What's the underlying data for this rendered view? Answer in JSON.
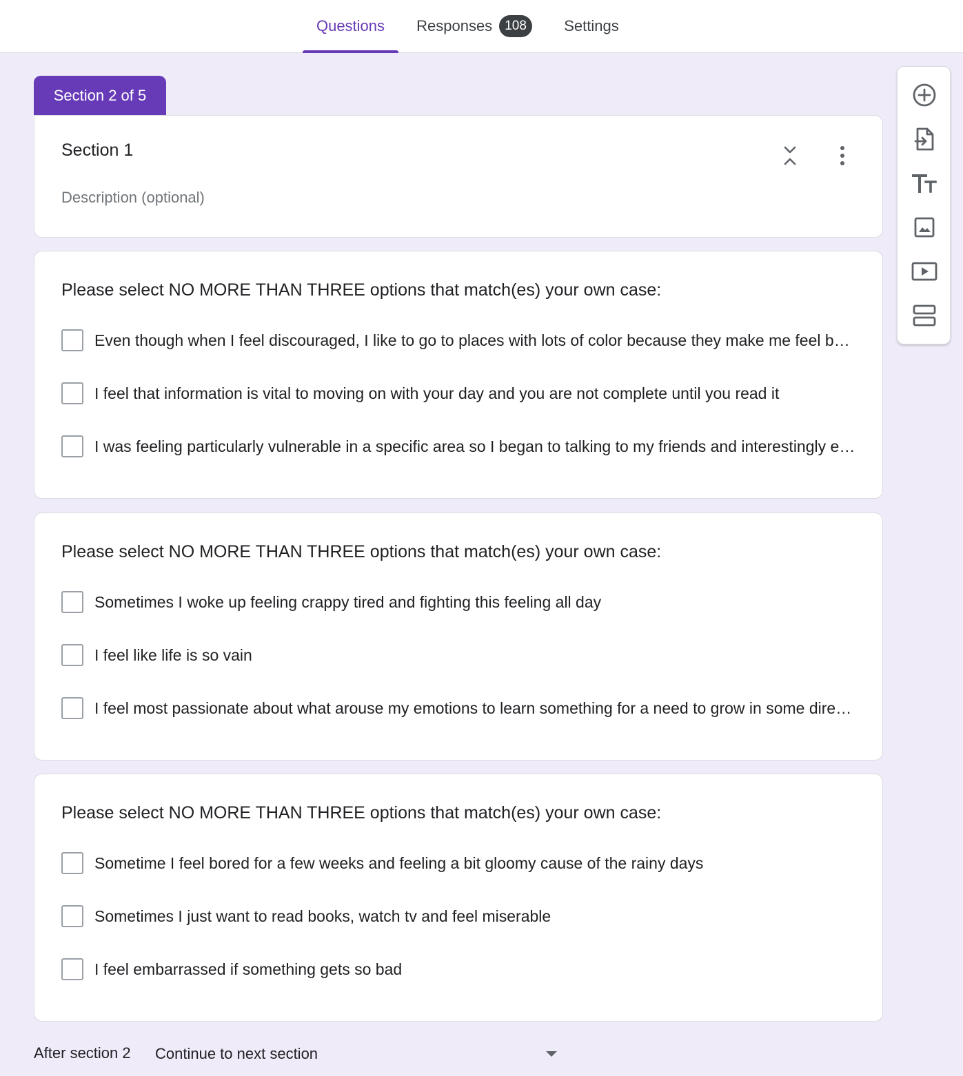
{
  "tabs": {
    "questions": "Questions",
    "responses": "Responses",
    "responses_count": "108",
    "settings": "Settings"
  },
  "section": {
    "label": "Section 2 of 5",
    "title": "Section 1",
    "description_placeholder": "Description (optional)"
  },
  "questions": [
    {
      "title": "Please select NO MORE THAN THREE options that match(es) your own case:",
      "options": [
        "Even though when I feel discouraged, I like to go to places with lots of color because they make me feel better",
        "I feel that information is vital to moving on with your day and you are not complete until you read it",
        "I was feeling particularly vulnerable in a specific area so I began to talking to my friends and interestingly enough"
      ]
    },
    {
      "title": "Please select NO MORE THAN THREE options that match(es) your own case:",
      "options": [
        "Sometimes I woke up feeling crappy tired and fighting this feeling all day",
        "I feel like life is so vain",
        "I feel most passionate about what arouse my emotions to learn something for a need to grow in some direction"
      ]
    },
    {
      "title": "Please select NO MORE THAN THREE options that match(es) your own case:",
      "options": [
        "Sometime I feel bored for a few weeks and feeling a bit gloomy cause of the rainy days",
        "Sometimes I just want to read books, watch tv and feel miserable",
        "I feel embarrassed if something gets so bad"
      ]
    }
  ],
  "footer": {
    "after_label": "After section 2",
    "after_value": "Continue to next section"
  },
  "toolbar_icons": [
    "add-circle-icon",
    "import-questions-icon",
    "title-text-icon",
    "image-icon",
    "video-icon",
    "section-icon"
  ],
  "colors": {
    "accent": "#673ab7",
    "background": "#f0ebf8",
    "badge": "#3c4043"
  }
}
